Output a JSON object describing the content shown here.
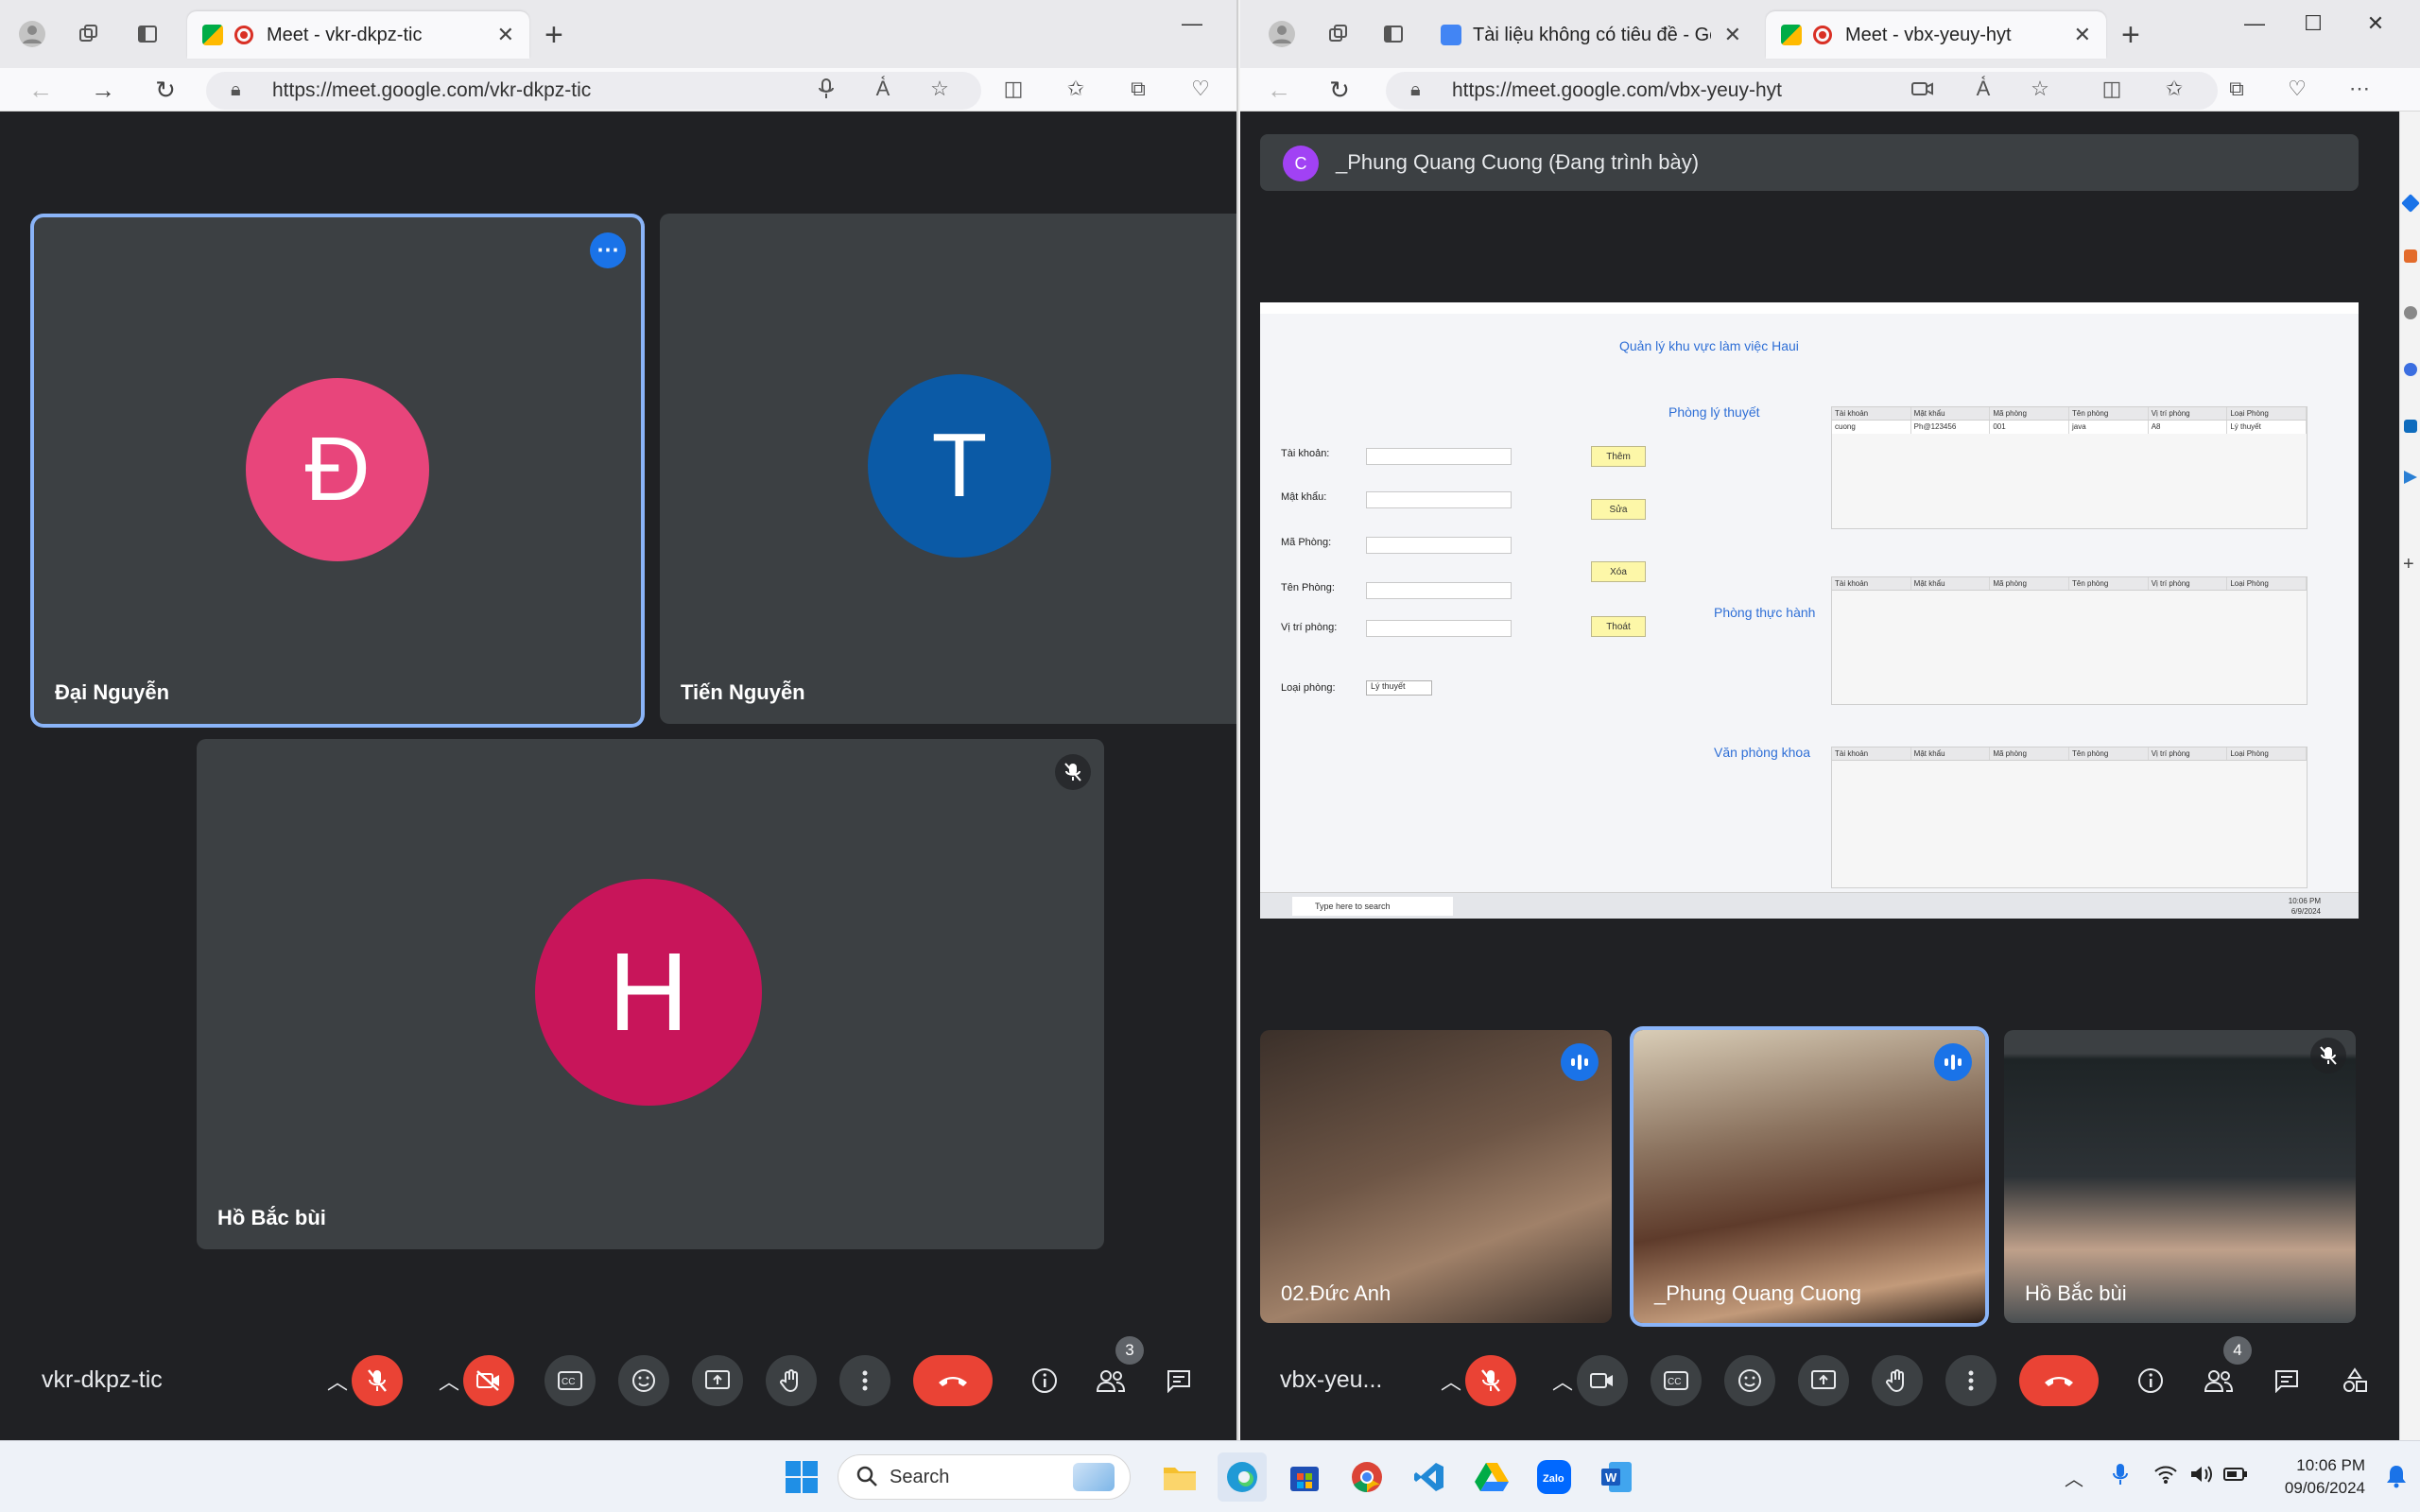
{
  "left_window": {
    "tab_title": "Meet - vkr-dkpz-tic",
    "url": "https://meet.google.com/vkr-dkpz-tic",
    "meeting_code": "vkr-dkpz-tic",
    "participants_count": "3",
    "tiles": [
      {
        "initial": "Đ",
        "name": "Đại Nguyễn",
        "color": "#e8457b"
      },
      {
        "initial": "T",
        "name": "Tiến Nguyễn",
        "color": "#0b5aa6"
      },
      {
        "initial": "H",
        "name": "Hồ Bắc bùi",
        "color": "#c8155a"
      }
    ]
  },
  "right_window": {
    "tabs": [
      {
        "title": "Tài liệu không có tiêu đề - Googl"
      },
      {
        "title": "Meet - vbx-yeuy-hyt"
      }
    ],
    "url": "https://meet.google.com/vbx-yeuy-hyt",
    "presenter_initial": "C",
    "presenter_banner": "_Phung Quang Cuong (Đang trình bày)",
    "meeting_code": "vbx-yeu...",
    "participants_count": "4",
    "cameras": [
      {
        "name": "02.Đức Anh"
      },
      {
        "name": "_Phung Quang Cuong"
      },
      {
        "name": "Hồ Bắc bùi"
      }
    ]
  },
  "shared_app": {
    "title": "Quản lý khu vực làm việc Haui",
    "sections": [
      "Phòng lý thuyết",
      "Phòng thực hành",
      "Văn phòng khoa"
    ],
    "labels": [
      "Tài khoản:",
      "Mật khẩu:",
      "Mã Phòng:",
      "Tên Phòng:",
      "Vị trí phòng:",
      "Loại phòng:"
    ],
    "buttons": [
      "Thêm",
      "Sửa",
      "Xóa",
      "Thoát"
    ],
    "combo_value": "Lý thuyết",
    "table_headers": [
      "Tài khoản",
      "Mật khẩu",
      "Mã phòng",
      "Tên phòng",
      "Vị trí phòng",
      "Loại Phòng"
    ],
    "table_row": [
      "cuong",
      "Ph@123456",
      "001",
      "java",
      "A8",
      "Lý thuyết"
    ],
    "taskbar_search": "Type here to search",
    "taskbar_time": "10:06 PM",
    "taskbar_date": "6/9/2024"
  },
  "os_taskbar": {
    "search_label": "Search",
    "time": "10:06 PM",
    "date": "09/06/2024"
  },
  "colors": {
    "meet_bg": "#202124",
    "tile_bg": "#3c4043",
    "end_call": "#ea4335",
    "accent_blue": "#1a73e8"
  }
}
